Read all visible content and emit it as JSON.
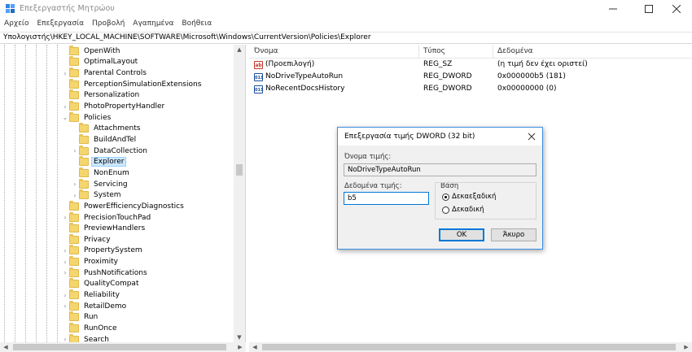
{
  "window": {
    "title": "Επεξεργαστής Μητρώου"
  },
  "menu": [
    "Αρχείο",
    "Επεξεργασία",
    "Προβολή",
    "Αγαπημένα",
    "Βοήθεια"
  ],
  "address": "Υπολογιστής\\HKEY_LOCAL_MACHINE\\SOFTWARE\\Microsoft\\Windows\\CurrentVersion\\Policies\\Explorer",
  "tree": {
    "items": [
      {
        "label": "OpenWith",
        "expander": "none",
        "level": 1
      },
      {
        "label": "OptimalLayout",
        "expander": "none",
        "level": 1
      },
      {
        "label": "Parental Controls",
        "expander": "collapsed",
        "level": 1
      },
      {
        "label": "PerceptionSimulationExtensions",
        "expander": "none",
        "level": 1
      },
      {
        "label": "Personalization",
        "expander": "none",
        "level": 1
      },
      {
        "label": "PhotoPropertyHandler",
        "expander": "collapsed",
        "level": 1
      },
      {
        "label": "Policies",
        "expander": "expanded",
        "level": 1
      },
      {
        "label": "Attachments",
        "expander": "none",
        "level": 2
      },
      {
        "label": "BuildAndTel",
        "expander": "none",
        "level": 2
      },
      {
        "label": "DataCollection",
        "expander": "collapsed",
        "level": 2
      },
      {
        "label": "Explorer",
        "expander": "none",
        "level": 2,
        "selected": true
      },
      {
        "label": "NonEnum",
        "expander": "none",
        "level": 2
      },
      {
        "label": "Servicing",
        "expander": "collapsed",
        "level": 2
      },
      {
        "label": "System",
        "expander": "collapsed",
        "level": 2
      },
      {
        "label": "PowerEfficiencyDiagnostics",
        "expander": "none",
        "level": 1
      },
      {
        "label": "PrecisionTouchPad",
        "expander": "collapsed",
        "level": 1
      },
      {
        "label": "PreviewHandlers",
        "expander": "none",
        "level": 1
      },
      {
        "label": "Privacy",
        "expander": "none",
        "level": 1
      },
      {
        "label": "PropertySystem",
        "expander": "collapsed",
        "level": 1
      },
      {
        "label": "Proximity",
        "expander": "collapsed",
        "level": 1
      },
      {
        "label": "PushNotifications",
        "expander": "collapsed",
        "level": 1
      },
      {
        "label": "QualityCompat",
        "expander": "none",
        "level": 1
      },
      {
        "label": "Reliability",
        "expander": "collapsed",
        "level": 1
      },
      {
        "label": "RetailDemo",
        "expander": "collapsed",
        "level": 1
      },
      {
        "label": "Run",
        "expander": "none",
        "level": 1
      },
      {
        "label": "RunOnce",
        "expander": "none",
        "level": 1
      },
      {
        "label": "Search",
        "expander": "collapsed",
        "level": 1
      }
    ]
  },
  "list": {
    "headers": {
      "name": "Όνομα",
      "type": "Τύπος",
      "data": "Δεδομένα"
    },
    "rows": [
      {
        "icon": "string-value-icon",
        "icon_text": "ab",
        "name": "(Προεπιλογή)",
        "type": "REG_SZ",
        "data": "(η τιμή δεν έχει οριστεί)"
      },
      {
        "icon": "binary-value-icon",
        "icon_text": "011",
        "name": "NoDriveTypeAutoRun",
        "type": "REG_DWORD",
        "data": "0x000000b5 (181)"
      },
      {
        "icon": "binary-value-icon",
        "icon_text": "011",
        "name": "NoRecentDocsHistory",
        "type": "REG_DWORD",
        "data": "0x00000000 (0)"
      }
    ]
  },
  "dialog": {
    "title": "Επεξεργασία τιμής DWORD (32 bit)",
    "name_label": "Όνομα τιμής:",
    "name_value": "NoDriveTypeAutoRun",
    "value_label": "Δεδομένα τιμής:",
    "value": "b5",
    "base_label": "Βάση",
    "radio_hex": "Δεκαεξαδική",
    "radio_dec": "Δεκαδική",
    "ok_label": "OK",
    "cancel_label": "Άκυρο",
    "selected_base": "hex"
  },
  "colors": {
    "selection": "#cce8ff",
    "dialog_border": "#3c8ee0",
    "folder": "#f5d56e"
  }
}
